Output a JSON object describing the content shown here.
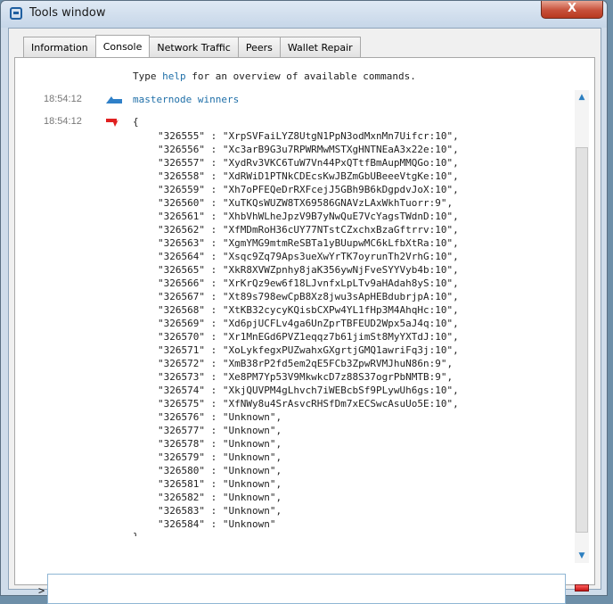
{
  "window": {
    "title": "Tools window",
    "close_label": "X"
  },
  "tabs": [
    {
      "label": "Information"
    },
    {
      "label": "Console"
    },
    {
      "label": "Network Traffic"
    },
    {
      "label": "Peers"
    },
    {
      "label": "Wallet Repair"
    }
  ],
  "console": {
    "help_prefix": "Type ",
    "help_keyword": "help",
    "help_suffix": " for an overview of available commands.",
    "entries": [
      {
        "time": "18:54:12",
        "direction": "request",
        "text": "masternode winners"
      },
      {
        "time": "18:54:12",
        "direction": "reply",
        "open": "{",
        "close": "}"
      }
    ],
    "reply_rows": [
      "\"326555\" : \"XrpSVFaiLYZ8UtgN1PpN3odMxnMn7Uifcr:10\",",
      "\"326556\" : \"Xc3arB9G3u7RPWRMwMSTXgHNTNEaA3x22e:10\",",
      "\"326557\" : \"XydRv3VKC6TuW7Vn44PxQTtfBmAupMMQGo:10\",",
      "\"326558\" : \"XdRWiD1PTNkCDEcsKwJBZmGbUBeeeVtgKe:10\",",
      "\"326559\" : \"Xh7oPFEQeDrRXFcejJ5GBh9B6kDgpdvJoX:10\",",
      "\"326560\" : \"XuTKQsWUZW8TX69586GNAVzLAxWkhTuorr:9\",",
      "\"326561\" : \"XhbVhWLheJpzV9B7yNwQuE7VcYagsTWdnD:10\",",
      "\"326562\" : \"XfMDmRoH36cUY77NTstCZxchxBzaGftrrv:10\",",
      "\"326563\" : \"XgmYMG9mtmReSBTa1yBUupwMC6kLfbXtRa:10\",",
      "\"326564\" : \"Xsqc9Zq79Aps3ueXwYrTK7oyrunTh2VrhG:10\",",
      "\"326565\" : \"XkR8XVWZpnhy8jaK356ywNjFveSYYVyb4b:10\",",
      "\"326566\" : \"XrKrQz9ew6f18LJvnfxLpLTv9aHAdah8yS:10\",",
      "\"326567\" : \"Xt89s798ewCpB8Xz8jwu3sApHEBdubrjpA:10\",",
      "\"326568\" : \"XtKB32cycyKQisbCXPw4YL1fHp3M4AhqHc:10\",",
      "\"326569\" : \"Xd6pjUCFLv4ga6UnZprTBFEUD2Wpx5aJ4q:10\",",
      "\"326570\" : \"Xr1MnEGd6PVZ1eqqz7b61jimSt8MyYXTdJ:10\",",
      "\"326571\" : \"XoLykfegxPUZwahxGXgrtjGMQ1awriFq3j:10\",",
      "\"326572\" : \"XmB38rP2fd5em2qE5FCb3ZpwRVMJhuN86n:9\",",
      "\"326573\" : \"Xe8PM7Yp53V9MkwkcD7z88S37ogrPbNMTB:9\",",
      "\"326574\" : \"XkjQUVPM4gLhvch7iWEBcbSf9PLywUh6gs:10\",",
      "\"326575\" : \"XfNWy8u4SrAsvcRHSfDm7xECSwcAsuUo5E:10\",",
      "\"326576\" : \"Unknown\",",
      "\"326577\" : \"Unknown\",",
      "\"326578\" : \"Unknown\",",
      "\"326579\" : \"Unknown\",",
      "\"326580\" : \"Unknown\",",
      "\"326581\" : \"Unknown\",",
      "\"326582\" : \"Unknown\",",
      "\"326583\" : \"Unknown\",",
      "\"326584\" : \"Unknown\""
    ]
  },
  "input": {
    "prompt": ">",
    "value": ""
  },
  "icons": {
    "request_arrow": "blue-request-arrow-icon",
    "reply_arrow": "red-reply-arrow-icon",
    "clear": "clear-console-icon"
  },
  "colors": {
    "request": "#2f80c8",
    "reply": "#e02020",
    "command": "#1f6fa8",
    "close": "#c7503a"
  }
}
